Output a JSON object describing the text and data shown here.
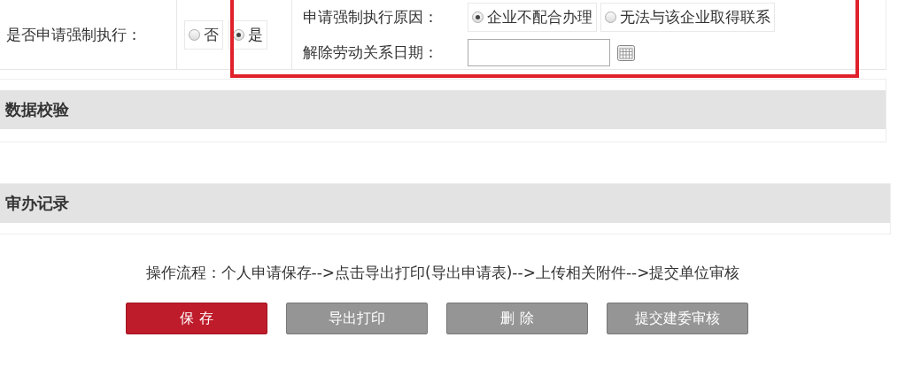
{
  "enforcement": {
    "label": "是否申请强制执行：",
    "options": [
      {
        "label": "否",
        "selected": false
      },
      {
        "label": "是",
        "selected": true
      }
    ],
    "reason_label": "申请强制执行原因：",
    "reasons": [
      {
        "label": "企业不配合办理",
        "selected": true
      },
      {
        "label": "无法与该企业取得联系",
        "selected": false
      }
    ],
    "date_label": "解除劳动关系日期：",
    "highlighted": true
  },
  "sections": [
    {
      "title": "数据校验"
    },
    {
      "title": "审办记录"
    }
  ],
  "flow_text": "操作流程：个人申请保存-->点击导出打印(导出申请表)-->上传相关附件-->提交单位审核",
  "buttons": [
    {
      "label": "保 存",
      "kind": "primary"
    },
    {
      "label": "导出打印",
      "kind": "secondary"
    },
    {
      "label": "删 除",
      "kind": "secondary"
    },
    {
      "label": "提交建委审核",
      "kind": "secondary"
    }
  ]
}
